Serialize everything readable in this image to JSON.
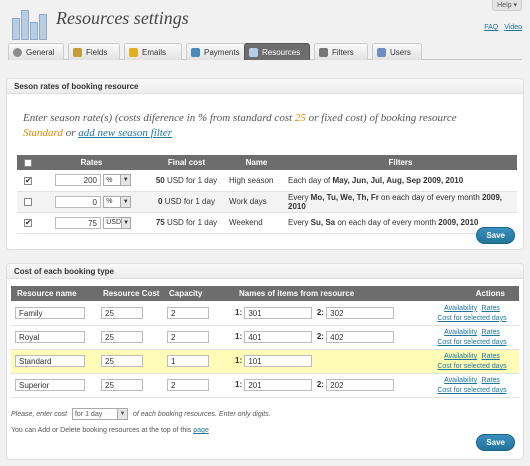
{
  "header": {
    "help": "Help",
    "title": "Resources settings",
    "faq": "FAQ",
    "video": "Video"
  },
  "tabs": [
    {
      "label": "General",
      "icon": "gear-icon",
      "color": "#8c8c8c"
    },
    {
      "label": "Fields",
      "icon": "pencil-icon",
      "color": "#c69b3a"
    },
    {
      "label": "Emails",
      "icon": "envelope-icon",
      "color": "#e0b020"
    },
    {
      "label": "Payments",
      "icon": "payment-icon",
      "color": "#4a8ab8"
    },
    {
      "label": "Resources",
      "icon": "resources-icon",
      "color": "#b7cde3"
    },
    {
      "label": "Filters",
      "icon": "filter-icon",
      "color": "#777"
    },
    {
      "label": "Users",
      "icon": "users-icon",
      "color": "#6b8fbf"
    }
  ],
  "season": {
    "heading": "Seson rates of booking resource",
    "intro_a": "Enter season rate(s) (costs diference in % from standard cost ",
    "intro_num": "25",
    "intro_b": " or fixed cost) of booking resource",
    "intro_resource": "Standard",
    "intro_or": " or ",
    "intro_link": "add new season filter",
    "cols": [
      "Rates",
      "Final cost",
      "Name",
      "Filters"
    ],
    "rows": [
      {
        "checked": true,
        "rate": "200",
        "unit": "%",
        "final_bold": "50",
        "final": " USD for 1 day",
        "name": "High season",
        "filter_pre": "Each day of ",
        "filter_bold": "May, Jun, Jul, Aug, Sep 2009, 2010",
        "filter_post": ""
      },
      {
        "checked": false,
        "rate": "0",
        "unit": "%",
        "final_bold": "0",
        "final": " USD for 1 day",
        "name": "Work days",
        "filter_pre": "Every ",
        "filter_bold": "Mo, Tu, We, Th, Fr",
        "filter_post": " on each day of every month ",
        "filter_bold2": "2009, 2010"
      },
      {
        "checked": true,
        "rate": "75",
        "unit": "USD",
        "final_bold": "75",
        "final": " USD for 1 day",
        "name": "Weekend",
        "filter_pre": "Every ",
        "filter_bold": "Su, Sa",
        "filter_post": " on each day of every month ",
        "filter_bold2": "2009, 2010"
      }
    ],
    "save": "Save"
  },
  "cost": {
    "heading": "Cost of each booking type",
    "cols": [
      "Resource name",
      "Resource Cost",
      "Capacity",
      "Names of items from resource",
      "Actions"
    ],
    "rows": [
      {
        "name": "Family",
        "cost": "25",
        "capacity": "2",
        "i1": "301",
        "i2": "302"
      },
      {
        "name": "Royal",
        "cost": "25",
        "capacity": "2",
        "i1": "401",
        "i2": "402"
      },
      {
        "name": "Standard",
        "cost": "25",
        "capacity": "1",
        "i1": "101",
        "i2": ""
      },
      {
        "name": "Superior",
        "cost": "25",
        "capacity": "2",
        "i1": "201",
        "i2": "202"
      }
    ],
    "item_label_1": "1:",
    "item_label_2": "2:",
    "availability": "Availability",
    "rates": "Rates",
    "cost_for_selected": "Cost for selected days",
    "note_a": "Please, enter cost",
    "period": "for 1 day",
    "note_b": "of each booking resources. Enter only digits.",
    "note_c": "You can Add or Delete booking resources at the top of this",
    "note_link": "page",
    "save": "Save"
  }
}
